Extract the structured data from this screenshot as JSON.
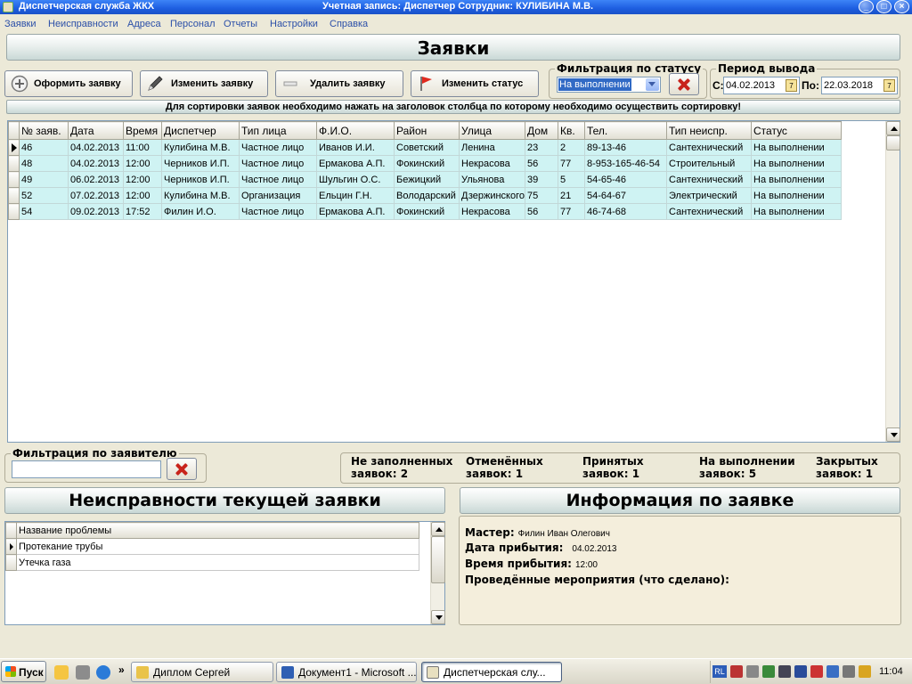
{
  "window": {
    "title": "Диспетчерская служба ЖКХ",
    "account": "Учетная запись:  Диспетчер   Сотрудник: КУЛИБИНА М.В."
  },
  "menu": [
    "Заявки",
    "Неисправности",
    "Адреса",
    "Персонал",
    "Отчеты",
    "Настройки",
    "Справка"
  ],
  "header": {
    "title": "Заявки"
  },
  "toolbar": {
    "create": "Оформить заявку",
    "edit": "Изменить заявку",
    "delete": "Удалить заявку",
    "status": "Изменить статус"
  },
  "status_filter": {
    "label": "Фильтрация по статусу",
    "value": "На выполнении"
  },
  "period": {
    "label": "Период вывода",
    "from_label": "С:",
    "from": "04.02.2013",
    "to_label": "По:",
    "to": "22.03.2018"
  },
  "hint": "Для сортировки заявок необходимо нажать на заголовок столбца по которому необходимо осуществить сортировку!",
  "grid": {
    "columns": [
      "№ заяв.",
      "Дата",
      "Время",
      "Диспетчер",
      "Тип лица",
      "Ф.И.О.",
      "Район",
      "Улица",
      "Дом",
      "Кв.",
      "Тел.",
      "Тип неиспр.",
      "Статус"
    ],
    "rows": [
      [
        "46",
        "04.02.2013",
        "11:00",
        "Кулибина М.В.",
        "Частное лицо",
        "Иванов И.И.",
        "Советский",
        "Ленина",
        "23",
        "2",
        "89-13-46",
        "Сантехнический",
        "На выполнении"
      ],
      [
        "48",
        "04.02.2013",
        "12:00",
        "Черников И.П.",
        "Частное лицо",
        "Ермакова А.П.",
        "Фокинский",
        "Некрасова",
        "56",
        "77",
        "8-953-165-46-54",
        "Строительный",
        "На выполнении"
      ],
      [
        "49",
        "06.02.2013",
        "12:00",
        "Черников И.П.",
        "Частное лицо",
        "Шульгин О.С.",
        "Бежицкий",
        "Ульянова",
        "39",
        "5",
        "54-65-46",
        "Сантехнический",
        "На выполнении"
      ],
      [
        "52",
        "07.02.2013",
        "12:00",
        "Кулибина М.В.",
        "Организация",
        "Ельцин Г.Н.",
        "Володарский",
        "Дзержинского",
        "75",
        "21",
        "54-64-67",
        "Электрический",
        "На выполнении"
      ],
      [
        "54",
        "09.02.2013",
        "17:52",
        "Филин И.О.",
        "Частное лицо",
        "Ермакова А.П.",
        "Фокинский",
        "Некрасова",
        "56",
        "77",
        "46-74-68",
        "Сантехнический",
        "На выполнении"
      ]
    ]
  },
  "applicant_filter": {
    "label": "Фильтрация по заявителю",
    "value": ""
  },
  "counts": [
    {
      "line1": "Не заполненных",
      "line2": "заявок: 2"
    },
    {
      "line1": "Отменённых",
      "line2": "заявок: 1"
    },
    {
      "line1": "Принятых",
      "line2": "заявок: 1"
    },
    {
      "line1": "На выполнении",
      "line2": "заявок: 5"
    },
    {
      "line1": "Закрытых",
      "line2": "заявок: 1"
    }
  ],
  "faults": {
    "title": "Неисправности текущей заявки",
    "column": "Название проблемы",
    "items": [
      "Протекание трубы",
      "Утечка газа"
    ]
  },
  "info": {
    "title": "Информация по заявке",
    "master_label": "Мастер:",
    "master": "Филин Иван Олегович",
    "arrival_date_label": "Дата прибытия:",
    "arrival_date": "04.02.2013",
    "arrival_time_label": "Время прибытия:",
    "arrival_time": "12:00",
    "done_label": "Проведённые мероприятия (что сделано):"
  },
  "taskbar": {
    "start": "Пуск",
    "tasks": [
      "Диплом Сергей",
      "Документ1 - Microsoft ...",
      "Диспетчерская слу..."
    ],
    "lang": "RL",
    "clock": "11:04"
  }
}
